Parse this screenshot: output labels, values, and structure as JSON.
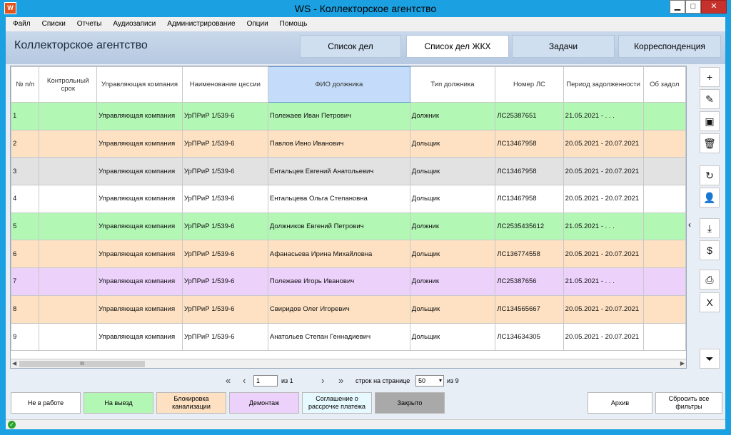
{
  "window": {
    "title": "WS - Коллекторское агентство",
    "app_icon": "W",
    "min": "▁",
    "max": "□",
    "close": "✕"
  },
  "menu": [
    "Файл",
    "Списки",
    "Отчеты",
    "Аудиозаписи",
    "Администрирование",
    "Опции",
    "Помощь"
  ],
  "header": {
    "title": "Коллекторское агентство",
    "tabs": [
      {
        "label": "Список дел",
        "active": false
      },
      {
        "label": "Список дел ЖКХ",
        "active": true
      },
      {
        "label": "Задачи",
        "active": false
      },
      {
        "label": "Корреспонденция",
        "active": false
      }
    ]
  },
  "grid": {
    "columns": [
      "№ п/п",
      "Контрольный срок",
      "Управляющая компания",
      "Наименование цессии",
      "ФИО должника",
      "Тип должника",
      "Номер ЛС",
      "Период задолженности",
      "Об задол"
    ],
    "rows": [
      {
        "color": "#b3f7b5",
        "cells": [
          "1",
          "",
          "Управляющая компания",
          "УрПРиР 1/539-6",
          "Полежаев Иван Петрович",
          "Должник",
          "ЛС25387651",
          "21.05.2021 - . . .",
          ""
        ]
      },
      {
        "color": "#fde1c2",
        "cells": [
          "2",
          "",
          "Управляющая компания",
          "УрПРиР 1/539-6",
          "Павлов Ивно Иванович",
          "Дольщик",
          "ЛС13467958",
          "20.05.2021 - 20.07.2021",
          ""
        ]
      },
      {
        "color": "#e2e2e2",
        "cells": [
          "3",
          "",
          "Управляющая компания",
          "УрПРиР 1/539-6",
          "Ентальцев Евгений Анатольевич",
          "Дольщик",
          "ЛС13467958",
          "20.05.2021 - 20.07.2021",
          ""
        ]
      },
      {
        "color": "#ffffff",
        "cells": [
          "4",
          "",
          "Управляющая компания",
          "УрПРиР 1/539-6",
          "Ентальцева Ольга Степановна",
          "Дольщик",
          "ЛС13467958",
          "20.05.2021 - 20.07.2021",
          ""
        ]
      },
      {
        "color": "#b3f7b5",
        "cells": [
          "5",
          "",
          "Управляющая компания",
          "УрПРиР 1/539-6",
          "Должников Евгений Петрович",
          "Должник",
          "ЛС2535435612",
          "21.05.2021 - . . .",
          ""
        ]
      },
      {
        "color": "#fde1c2",
        "cells": [
          "6",
          "",
          "Управляющая компания",
          "УрПРиР 1/539-6",
          "Афанасьева Ирина Михайловна",
          "Дольщик",
          "ЛС136774558",
          "20.05.2021 - 20.07.2021",
          ""
        ]
      },
      {
        "color": "#ecd1fb",
        "cells": [
          "7",
          "",
          "Управляющая компания",
          "УрПРиР 1/539-6",
          "Полежаев Игорь Иванович",
          "Должник",
          "ЛС25387656",
          "21.05.2021 - . . .",
          ""
        ]
      },
      {
        "color": "#fde1c2",
        "cells": [
          "8",
          "",
          "Управляющая компания",
          "УрПРиР 1/539-6",
          "Свиридов Олег Игоревич",
          "Дольщик",
          "ЛС134565667",
          "20.05.2021 - 20.07.2021",
          ""
        ]
      },
      {
        "color": "#ffffff",
        "cells": [
          "9",
          "",
          "Управляющая компания",
          "УрПРиР 1/539-6",
          "Анатольев Степан Геннадиевич",
          "Дольщик",
          "ЛС134634305",
          "20.05.2021 - 20.07.2021",
          ""
        ]
      }
    ],
    "scroll_thumb": "III"
  },
  "side_toolbar": [
    {
      "name": "add-icon",
      "glyph": "+"
    },
    {
      "name": "edit-icon",
      "glyph": "✎"
    },
    {
      "name": "archive-icon",
      "glyph": "▣"
    },
    {
      "name": "delete-icon",
      "glyph": "🗑"
    },
    {
      "name": "refresh-icon",
      "glyph": "↻"
    },
    {
      "name": "user-icon",
      "glyph": "👤"
    },
    {
      "name": "download-icon",
      "glyph": "⤓"
    },
    {
      "name": "dollar-icon",
      "glyph": "$"
    },
    {
      "name": "print-icon",
      "glyph": "⎙"
    },
    {
      "name": "excel-icon",
      "glyph": "X"
    },
    {
      "name": "filter-add-icon",
      "glyph": "⏷"
    }
  ],
  "collapse_glyph": "‹",
  "pager": {
    "first": "«",
    "prev": "‹",
    "page": "1",
    "of_pages": "из 1",
    "next": "›",
    "last": "»",
    "rows_label": "строк на странице",
    "page_size": "50",
    "dropdown": "▾",
    "of_rows": "из 9"
  },
  "legend": [
    {
      "label": "Не в работе",
      "color": "#ffffff"
    },
    {
      "label": "На выезд",
      "color": "#b3f7b5"
    },
    {
      "label": "Блокировка канализации",
      "color": "#fde1c2"
    },
    {
      "label": "Демонтаж",
      "color": "#ecd1fb"
    },
    {
      "label": "Соглашение о рассрочке платежа",
      "color": "#e6f9ff"
    },
    {
      "label": "Закрыто",
      "color": "#a9a9a9"
    }
  ],
  "actions": {
    "archive": "Архив",
    "reset_filters": "Сбросить все фильтры"
  },
  "status": {
    "ok": "✓"
  }
}
